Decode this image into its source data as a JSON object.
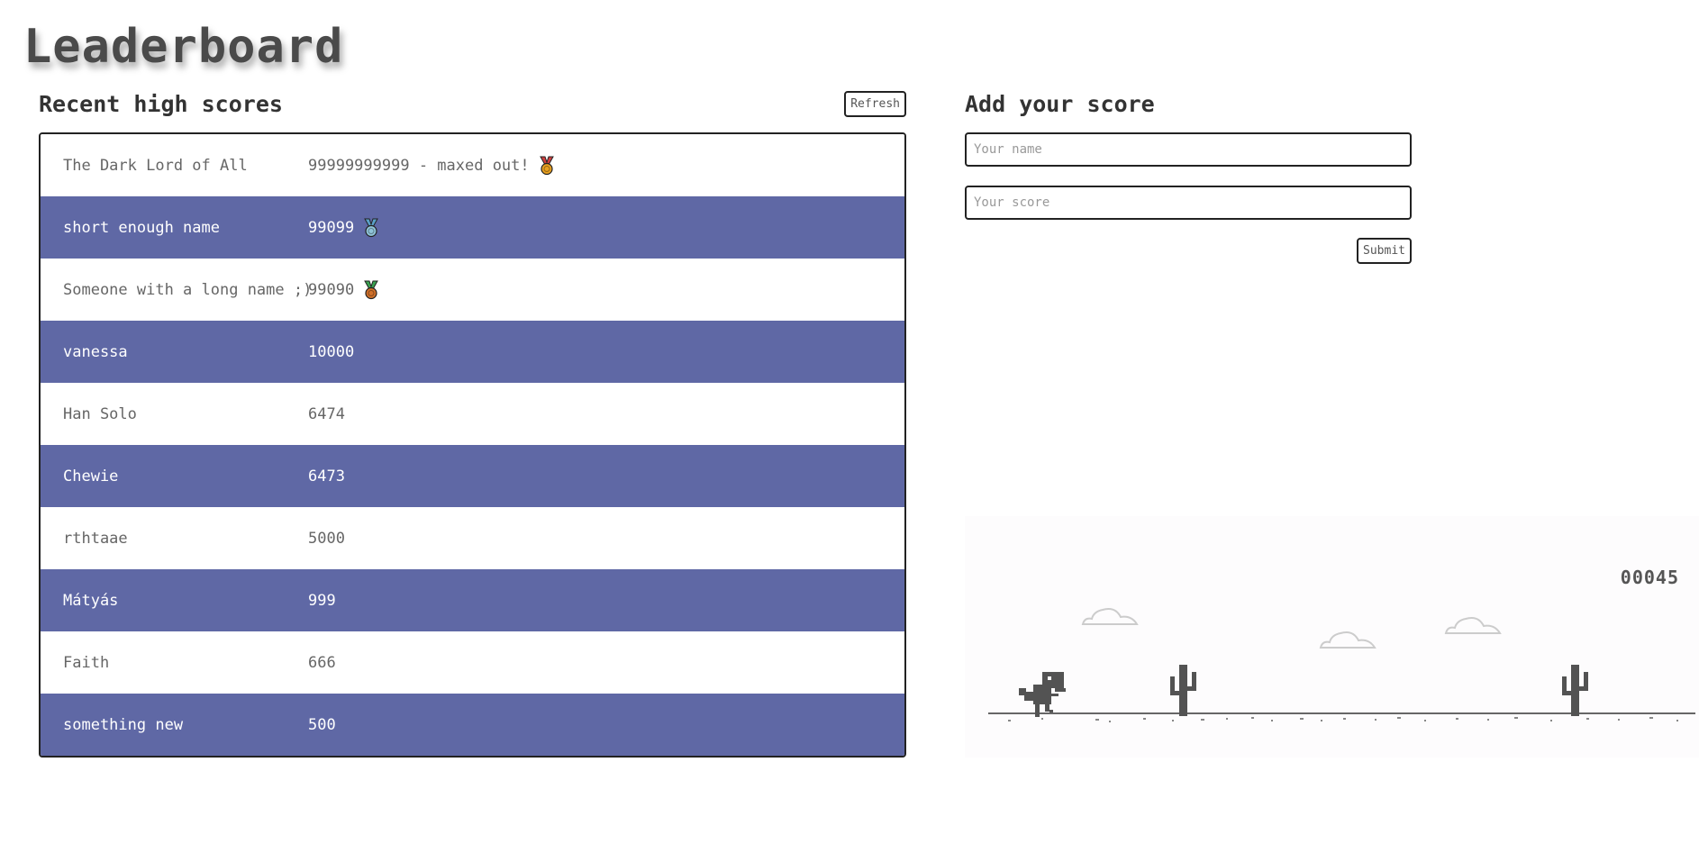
{
  "page": {
    "title": "Leaderboard"
  },
  "leaderboard": {
    "heading": "Recent high scores",
    "refresh_label": "Refresh",
    "rows": [
      {
        "name": "The Dark Lord of All",
        "score": "99999999999 - maxed out!",
        "medal": "gold"
      },
      {
        "name": "short enough name",
        "score": "99099",
        "medal": "silver"
      },
      {
        "name": "Someone with a long name ;)",
        "score": "99090",
        "medal": "bronze"
      },
      {
        "name": "vanessa",
        "score": "10000",
        "medal": ""
      },
      {
        "name": "Han Solo",
        "score": "6474",
        "medal": ""
      },
      {
        "name": "Chewie",
        "score": "6473",
        "medal": ""
      },
      {
        "name": "rthtaae",
        "score": "5000",
        "medal": ""
      },
      {
        "name": "Mátyás",
        "score": "999",
        "medal": ""
      },
      {
        "name": "Faith",
        "score": "666",
        "medal": ""
      },
      {
        "name": "something new",
        "score": "500",
        "medal": ""
      }
    ],
    "colors": {
      "alt_row": "#5f68a5",
      "gold": "#e8a020",
      "silver": "#8fc3d8",
      "bronze": "#d0702a",
      "ribbon_gold": "#d04040",
      "ribbon_silver": "#5aa0c8",
      "ribbon_bronze": "#3aa050"
    }
  },
  "add_score": {
    "heading": "Add your score",
    "name_placeholder": "Your name",
    "score_placeholder": "Your score",
    "submit_label": "Submit"
  },
  "game": {
    "score": "00045",
    "icons": [
      "t-rex-icon",
      "cactus-icon",
      "cloud-icon"
    ]
  }
}
